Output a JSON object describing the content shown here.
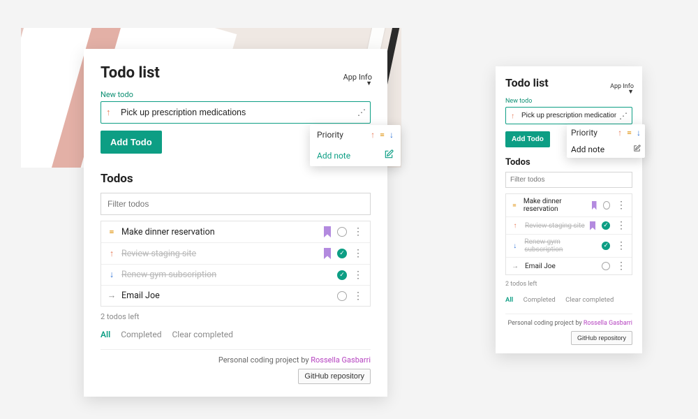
{
  "header": {
    "title": "Todo list",
    "app_info": "App Info"
  },
  "new_todo": {
    "label": "New todo",
    "value": "Pick up prescription medications",
    "add_button": "Add Todo"
  },
  "popover": {
    "priority_label": "Priority",
    "add_note_label": "Add note"
  },
  "todos": {
    "section_title": "Todos",
    "filter_placeholder": "Filter todos",
    "items": [
      {
        "priority": "eq",
        "text": "Make dinner reservation",
        "bookmarked": true,
        "done": false
      },
      {
        "priority": "up",
        "text": "Review staging site",
        "bookmarked": true,
        "done": true
      },
      {
        "priority": "down",
        "text": "Renew gym subscription",
        "bookmarked": false,
        "done": true
      },
      {
        "priority": "none",
        "text": "Email Joe",
        "bookmarked": false,
        "done": false
      }
    ],
    "remaining": "2 todos left"
  },
  "filters": {
    "all": "All",
    "completed": "Completed",
    "clear": "Clear completed"
  },
  "footer": {
    "credit_prefix": "Personal coding project by ",
    "author": "Rossella Gasbarri",
    "github": "GitHub repository"
  },
  "priority_glyph": {
    "up": "↑",
    "eq": "=",
    "down": "↓",
    "none": "→"
  }
}
